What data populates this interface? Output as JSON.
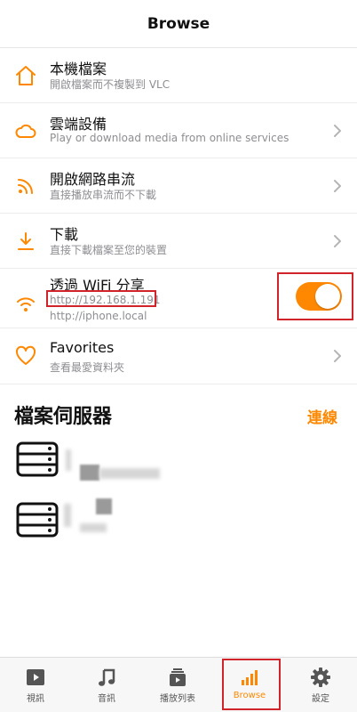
{
  "header": {
    "title": "Browse"
  },
  "list": [
    {
      "title": "本機檔案",
      "subtitle": "開啟檔案而不複製到 VLC",
      "icon": "home-icon",
      "chevron": false
    },
    {
      "title": "雲端設備",
      "subtitle": "Play or download media from online services",
      "icon": "cloud-icon",
      "chevron": true
    },
    {
      "title": "開啟網路串流",
      "subtitle": "直接播放串流而不下載",
      "icon": "rss-stream-icon",
      "chevron": true
    },
    {
      "title": "下載",
      "subtitle": "直接下載檔案至您的裝置",
      "icon": "download-icon",
      "chevron": true
    },
    {
      "title": "透過 WiFi 分享",
      "subtitle": "http://192.168.1.191",
      "subtitle2": "http://iphone.local",
      "icon": "wifi-icon",
      "toggle_on": true
    },
    {
      "title": "Favorites",
      "subtitle": "查看最愛資料夾",
      "icon": "heart-icon",
      "chevron": true
    }
  ],
  "servers": {
    "title": "檔案伺服器",
    "action": "連線",
    "items": [
      {
        "icon": "server-icon"
      },
      {
        "icon": "server-icon"
      }
    ]
  },
  "tabbar": {
    "active": "Browse",
    "tabs": [
      {
        "label": "視訊",
        "icon": "video-icon"
      },
      {
        "label": "音訊",
        "icon": "music-note-icon"
      },
      {
        "label": "播放列表",
        "icon": "playlist-icon"
      },
      {
        "label": "Browse",
        "icon": "browse-bars-icon"
      },
      {
        "label": "設定",
        "icon": "gear-icon"
      }
    ]
  },
  "colors": {
    "accent": "#ff8800",
    "highlight": "#d0232a",
    "muted_text": "#8e8e93"
  }
}
